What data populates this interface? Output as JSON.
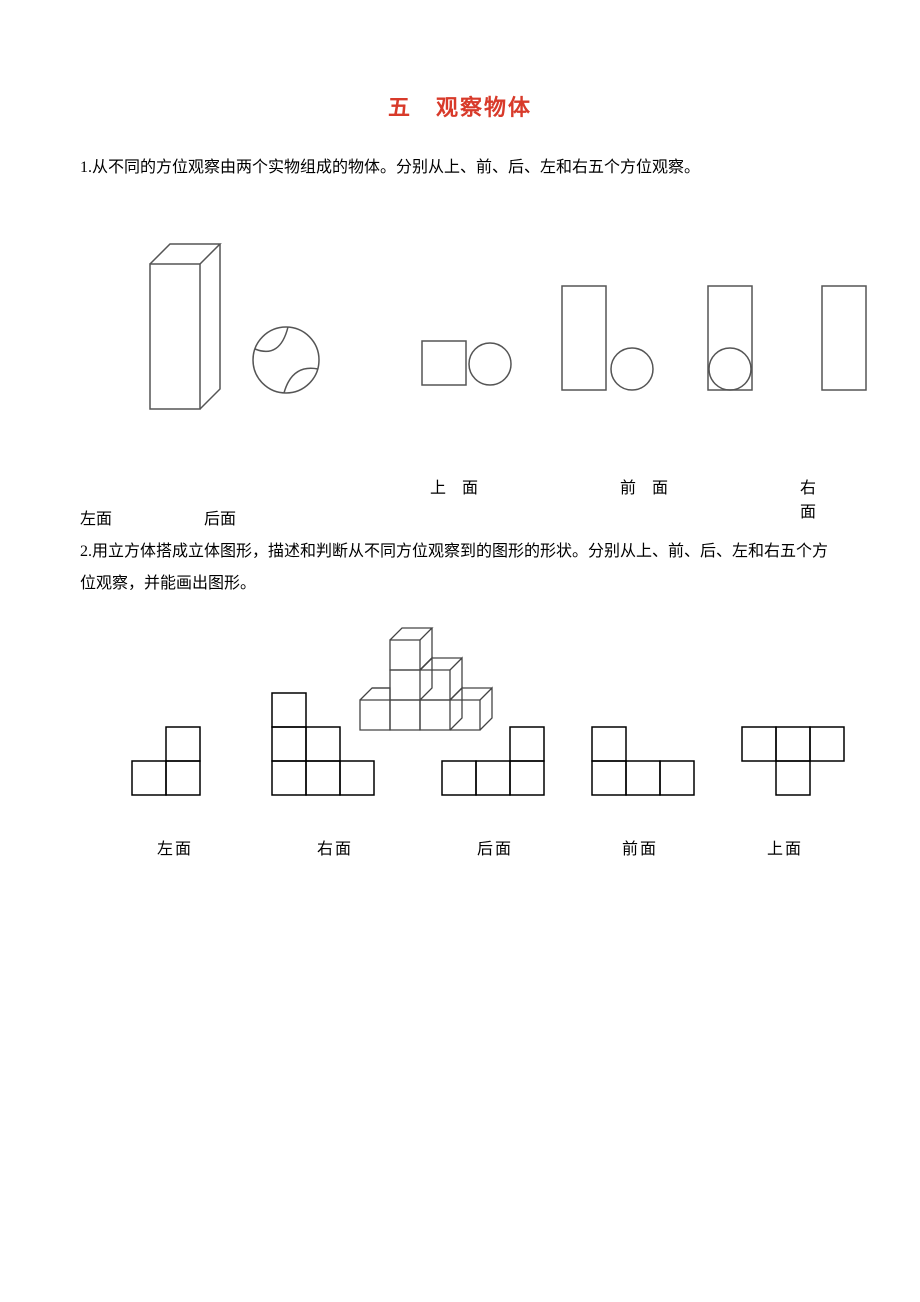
{
  "title": "五　观察物体",
  "q1": "1.从不同的方位观察由两个实物组成的物体。分别从上、前、后、左和右五个方位观察。",
  "row1_labels": {
    "top": "上 面",
    "front": "前 面",
    "right": "右 面",
    "left": "左面",
    "back": "后面"
  },
  "q2": "2.用立方体搭成立体图形，描述和判断从不同方位观察到的图形的形状。分别从上、前、后、左和右五个方位观察，并能画出图形。",
  "row2_labels": {
    "left": "左面",
    "right": "右面",
    "back": "后面",
    "front": "前面",
    "top": "上面"
  }
}
